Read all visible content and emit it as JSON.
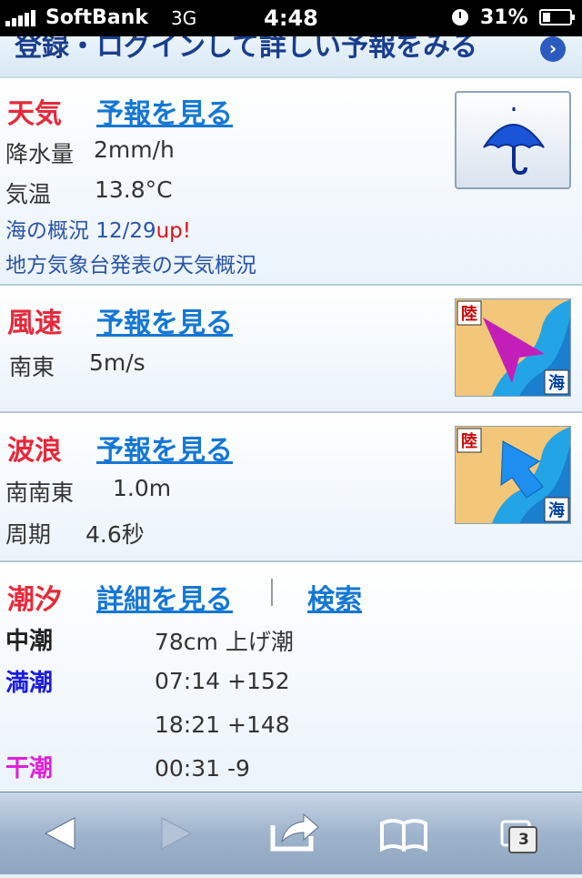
{
  "status_bar": {
    "carrier": "SoftBank",
    "network": "3G",
    "time": "4:48",
    "battery_percent": "31%",
    "battery_level": 0.31
  },
  "login_banner": {
    "text": "登録・ログインして詳しい予報をみる",
    "arrow_icon": "chevron-right-circle-icon"
  },
  "weather": {
    "title": "天気",
    "link": "予報を見る",
    "rain_label": "降水量",
    "rain_value": "2mm/h",
    "temp_label": "気温",
    "temp_value": "13.8°C",
    "sea_summary": "海の概況 12/29",
    "sea_summary_badge": "up!",
    "local_summary": "地方気象台発表の天気概況",
    "icon": "umbrella-icon"
  },
  "wind": {
    "title": "風速",
    "link": "予報を見る",
    "direction": "南東",
    "speed": "5m/s",
    "land_label": "陸",
    "sea_label": "海",
    "icon": "wind-direction-icon"
  },
  "waves": {
    "title": "波浪",
    "link": "予報を見る",
    "direction": "南南東",
    "height": "1.0m",
    "period_label": "周期",
    "period_value": "4.6秒",
    "land_label": "陸",
    "sea_label": "海",
    "icon": "wave-direction-icon"
  },
  "tide": {
    "title": "潮汐",
    "details_link": "詳細を見る",
    "separator": "|",
    "search_link": "検索",
    "type_label": "中潮",
    "current": "78cm 上げ潮",
    "high_label": "満潮",
    "high_1": "07:14 +152",
    "high_2": "18:21 +148",
    "low_label": "干潮",
    "low_1": "00:31 -9"
  },
  "toolbar": {
    "tab_count": "3",
    "icons": [
      "back-icon",
      "forward-icon",
      "share-icon",
      "bookmarks-icon",
      "tabs-icon"
    ]
  },
  "colors": {
    "title_red": "#e8283a",
    "link_blue": "#1477d4",
    "high_tide_blue": "#1a1ae0",
    "low_tide_magenta": "#e020d8"
  }
}
